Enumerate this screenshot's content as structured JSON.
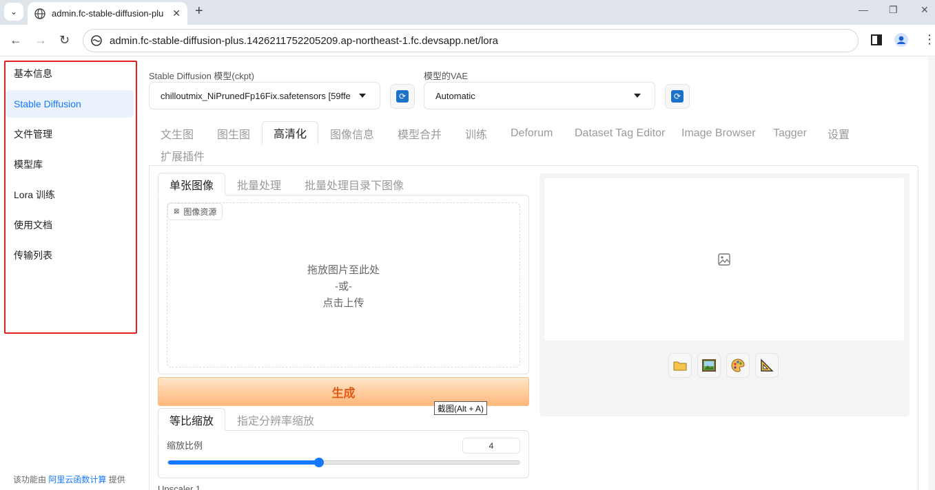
{
  "browser": {
    "tab_title": "admin.fc-stable-diffusion-plu",
    "url": "admin.fc-stable-diffusion-plus.1426211752205209.ap-northeast-1.fc.devsapp.net/lora"
  },
  "sidebar": {
    "items": [
      {
        "label": "基本信息",
        "active": false
      },
      {
        "label": "Stable Diffusion",
        "active": true
      },
      {
        "label": "文件管理",
        "active": false
      },
      {
        "label": "模型库",
        "active": false
      },
      {
        "label": "Lora 训练",
        "active": false
      },
      {
        "label": "使用文档",
        "active": false
      },
      {
        "label": "传输列表",
        "active": false
      }
    ],
    "footer_prefix": "该功能由",
    "footer_link": "阿里云函数计算",
    "footer_suffix": "提供"
  },
  "settings": {
    "ckpt_label": "Stable Diffusion 模型(ckpt)",
    "ckpt_value": "chilloutmix_NiPrunedFp16Fix.safetensors [59ffe",
    "vae_label": "模型的VAE",
    "vae_value": "Automatic"
  },
  "main_tabs": [
    "文生图",
    "图生图",
    "高清化",
    "图像信息",
    "模型合并",
    "训练",
    "Deforum",
    "Dataset Tag Editor",
    "Image Browser",
    "Tagger",
    "设置",
    "扩展插件"
  ],
  "active_main_tab": "高清化",
  "sub_tabs": [
    "单张图像",
    "批量处理",
    "批量处理目录下图像"
  ],
  "dropzone": {
    "source_label": "图像资源",
    "line1": "拖放图片至此处",
    "line2": "-或-",
    "line3": "点击上传"
  },
  "generate_label": "生成",
  "tooltip": "截图(Alt + A)",
  "resize_tabs": [
    "等比缩放",
    "指定分辨率缩放"
  ],
  "scale": {
    "label": "缩放比例",
    "value": "4",
    "fraction": 0.43
  },
  "upscaler_label": "Upscaler 1",
  "output_tools": [
    "folder-icon",
    "image-icon",
    "palette-icon",
    "ruler-icon"
  ],
  "colors": {
    "accent": "#1677ff",
    "highlight_border": "#e02020",
    "generate_text": "#e05a14"
  }
}
